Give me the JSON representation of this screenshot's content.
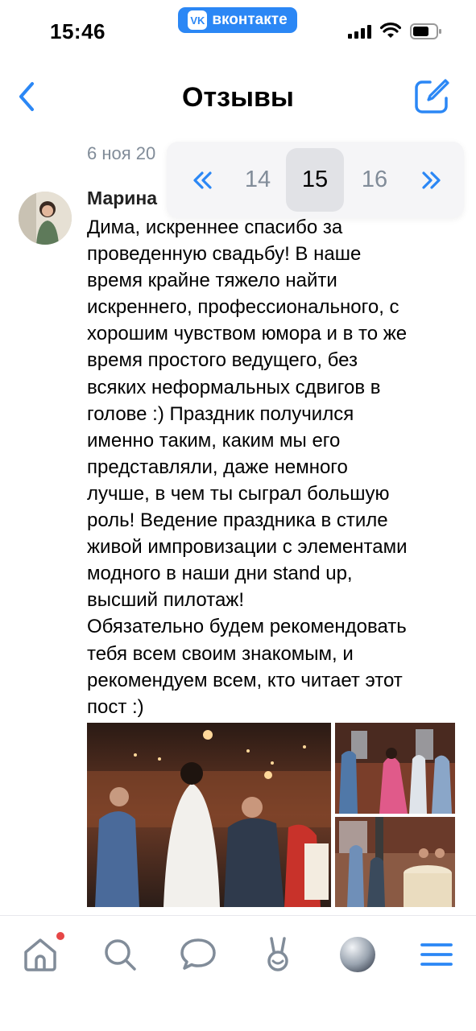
{
  "status_bar": {
    "time": "15:46",
    "vk_label": "вконтакте",
    "vk_logo": "VK"
  },
  "nav": {
    "title": "Отзывы",
    "back_icon": "chevron-left-icon",
    "edit_icon": "edit-icon"
  },
  "post": {
    "date": "6 ноя 20",
    "author": "Марина",
    "text": "Дима, искреннее спасибо за\nпроведенную свадьбу! В наше\nвремя крайне тяжело найти\nискреннего, профессионального, с\nхорошим чувством юмора и в то же\nвремя простого ведущего, без\nвсяких неформальных сдвигов в\nголове :) Праздник получился\nименно таким, каким мы его\nпредставляли, даже немного\nлучше, в чем ты сыграл большую\nроль! Ведение праздника в стиле\nживой импровизации с элементами\nмодного в наши дни stand up,\nвысший пилотаж!\nОбязательно будем рекомендовать\nтебя всем своим знакомым, и\nрекомендуем всем, кто читает этот\nпост :)"
  },
  "pager": {
    "prev_icon": "double-chevron-left-icon",
    "pages": [
      "14",
      "15",
      "16"
    ],
    "active": "15",
    "next_icon": "double-chevron-right-icon"
  },
  "tabbar": {
    "items": [
      "home-icon",
      "search-icon",
      "messages-icon",
      "clips-icon",
      "profile-icon",
      "menu-icon"
    ],
    "notification": true
  },
  "colors": {
    "accent": "#2b87f5",
    "secondary_text": "#818c99",
    "badge": "#e64646"
  }
}
